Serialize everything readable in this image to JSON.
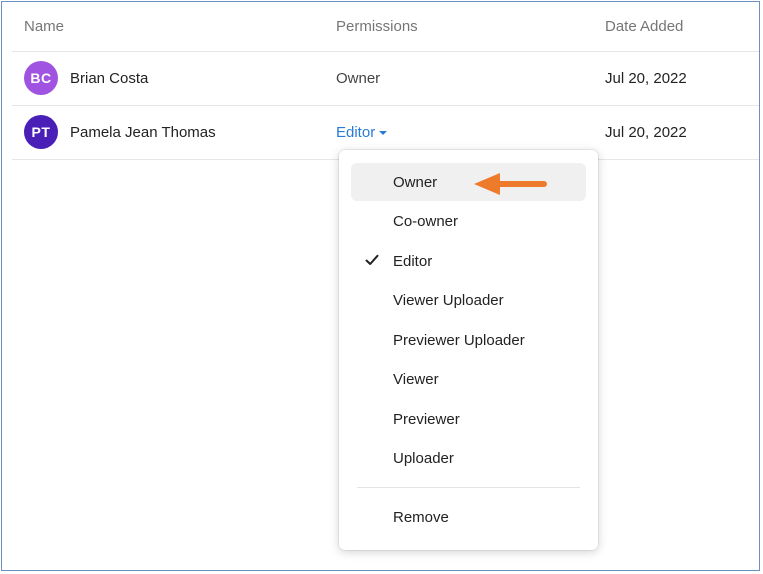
{
  "table": {
    "headers": {
      "name": "Name",
      "permissions": "Permissions",
      "date": "Date Added"
    },
    "rows": [
      {
        "initials": "BC",
        "avatar_color": "#a052e0",
        "name": "Brian Costa",
        "permission": "Owner",
        "date": "Jul 20, 2022"
      },
      {
        "initials": "PT",
        "avatar_color": "#4a1fb8",
        "name": "Pamela Jean Thomas",
        "permission": "Editor",
        "date": "Jul 20, 2022"
      }
    ]
  },
  "menu": {
    "items": [
      {
        "label": "Owner",
        "highlighted": true
      },
      {
        "label": "Co-owner"
      },
      {
        "label": "Editor",
        "checked": true
      },
      {
        "label": "Viewer Uploader"
      },
      {
        "label": "Previewer Uploader"
      },
      {
        "label": "Viewer"
      },
      {
        "label": "Previewer"
      },
      {
        "label": "Uploader"
      }
    ],
    "remove_label": "Remove"
  },
  "colors": {
    "accent": "#2a7bd6",
    "arrow": "#ee7a2c",
    "frame": "#6c90c2"
  },
  "icons": {
    "checkmark": "check-icon",
    "caret": "caret-down-icon",
    "annotation": "arrow-left-icon"
  }
}
